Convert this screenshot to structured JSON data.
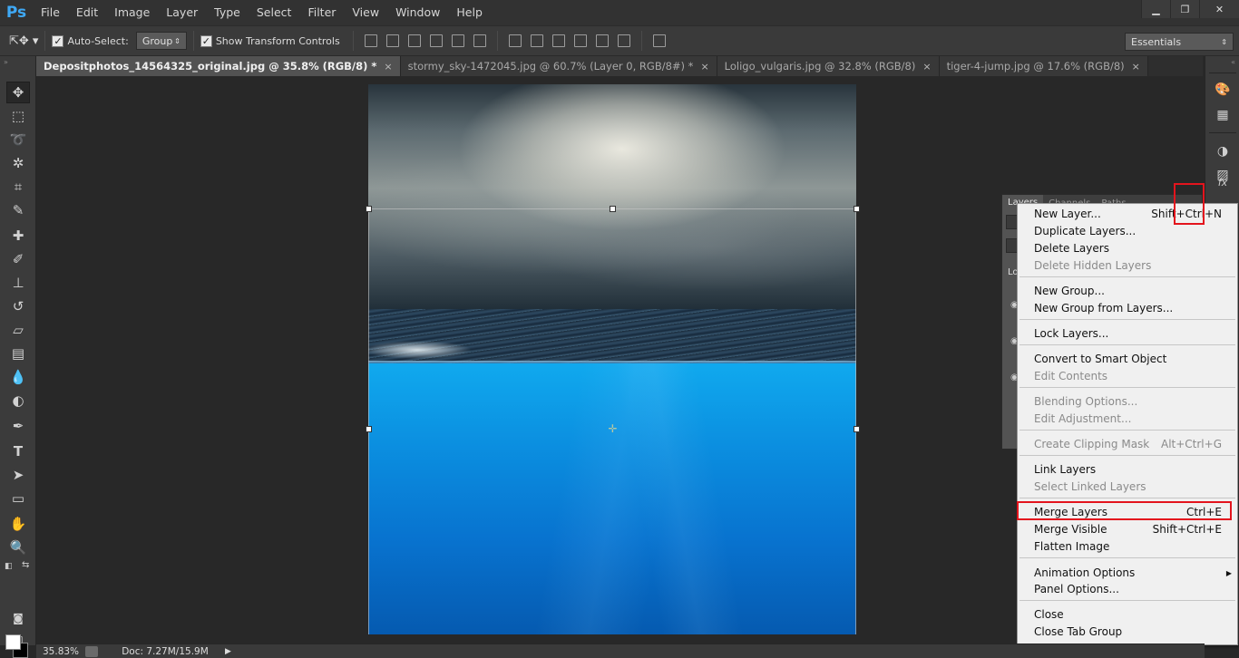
{
  "app": {
    "logo": "Ps"
  },
  "menus": [
    "File",
    "Edit",
    "Image",
    "Layer",
    "Type",
    "Select",
    "Filter",
    "View",
    "Window",
    "Help"
  ],
  "window_controls": {
    "minimize": "▁",
    "restore": "❐",
    "close": "✕"
  },
  "options_bar": {
    "auto_select_label": "Auto-Select:",
    "auto_select_checked": true,
    "auto_select_target": "Group",
    "show_transform_label": "Show Transform Controls",
    "show_transform_checked": true,
    "workspace": "Essentials"
  },
  "tabs": [
    {
      "label": "Depositphotos_14564325_original.jpg @ 35.8% (RGB/8) *",
      "close": "×",
      "active": true
    },
    {
      "label": "stormy_sky-1472045.jpg @ 60.7% (Layer 0, RGB/8#) *",
      "close": "×",
      "active": false
    },
    {
      "label": "Loligo_vulgaris.jpg @ 32.8% (RGB/8)",
      "close": "×",
      "active": false
    },
    {
      "label": "tiger-4-jump.jpg @ 17.6% (RGB/8)",
      "close": "×",
      "active": false
    }
  ],
  "tools": [
    "move-tool",
    "marquee-tool",
    "lasso-tool",
    "magic-wand-tool",
    "crop-tool",
    "eyedropper-tool",
    "healing-brush-tool",
    "brush-tool",
    "clone-stamp-tool",
    "history-brush-tool",
    "eraser-tool",
    "gradient-tool",
    "blur-tool",
    "dodge-tool",
    "pen-tool",
    "type-tool",
    "path-selection-tool",
    "rectangle-tool",
    "hand-tool",
    "zoom-tool"
  ],
  "colors": {
    "foreground": "#ffffff",
    "background": "#000000",
    "highlight": "#e3141d"
  },
  "layers_panel": {
    "tabs": [
      "Layers",
      "Channels",
      "Paths"
    ],
    "side_labels": [
      "Lo"
    ]
  },
  "context_menu": {
    "items": [
      {
        "label": "New Layer...",
        "shortcut": "Shift+Ctrl+N",
        "disabled": false
      },
      {
        "label": "Duplicate Layers...",
        "shortcut": "",
        "disabled": false
      },
      {
        "label": "Delete Layers",
        "shortcut": "",
        "disabled": false
      },
      {
        "label": "Delete Hidden Layers",
        "shortcut": "",
        "disabled": true
      },
      {
        "label": "New Group...",
        "shortcut": "",
        "disabled": false
      },
      {
        "label": "New Group from Layers...",
        "shortcut": "",
        "disabled": false
      },
      {
        "label": "Lock Layers...",
        "shortcut": "",
        "disabled": false
      },
      {
        "label": "Convert to Smart Object",
        "shortcut": "",
        "disabled": false
      },
      {
        "label": "Edit Contents",
        "shortcut": "",
        "disabled": true
      },
      {
        "label": "Blending Options...",
        "shortcut": "",
        "disabled": true
      },
      {
        "label": "Edit Adjustment...",
        "shortcut": "",
        "disabled": true
      },
      {
        "label": "Create Clipping Mask",
        "shortcut": "Alt+Ctrl+G",
        "disabled": true
      },
      {
        "label": "Link Layers",
        "shortcut": "",
        "disabled": false
      },
      {
        "label": "Select Linked Layers",
        "shortcut": "",
        "disabled": true
      },
      {
        "label": "Merge Layers",
        "shortcut": "Ctrl+E",
        "disabled": false
      },
      {
        "label": "Merge Visible",
        "shortcut": "Shift+Ctrl+E",
        "disabled": false
      },
      {
        "label": "Flatten Image",
        "shortcut": "",
        "disabled": false
      },
      {
        "label": "Animation Options",
        "shortcut": "",
        "disabled": false,
        "submenu": true
      },
      {
        "label": "Panel Options...",
        "shortcut": "",
        "disabled": false
      },
      {
        "label": "Close",
        "shortcut": "",
        "disabled": false
      },
      {
        "label": "Close Tab Group",
        "shortcut": "",
        "disabled": false
      }
    ]
  },
  "status": {
    "zoom": "35.83%",
    "doc_info": "Doc: 7.27M/15.9M",
    "arrow": "▶"
  }
}
